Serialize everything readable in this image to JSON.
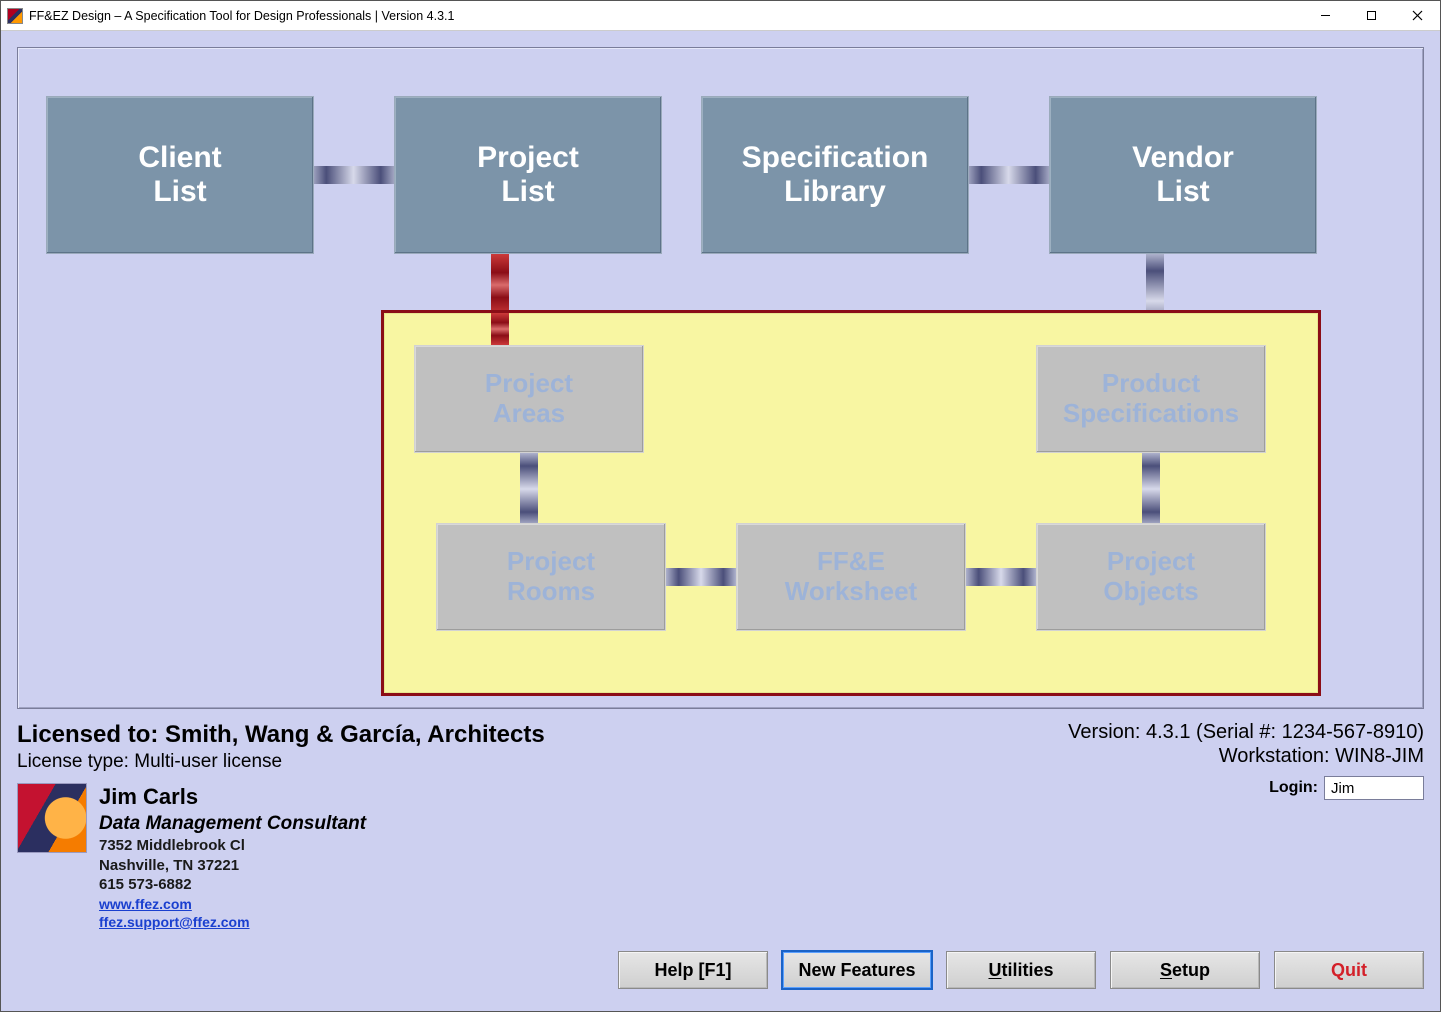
{
  "window": {
    "title": "FF&EZ Design – A Specification Tool for Design Professionals | Version 4.3.1"
  },
  "nodes": {
    "client_list": "Client\nList",
    "project_list": "Project\nList",
    "spec_library": "Specification\nLibrary",
    "vendor_list": "Vendor\nList",
    "project_areas": "Project\nAreas",
    "project_rooms": "Project\nRooms",
    "ffe_worksheet": "FF&E\nWorksheet",
    "project_objects": "Project\nObjects",
    "product_specs": "Product\nSpecifications"
  },
  "license": {
    "licensed_to_label": "Licensed to: ",
    "licensed_to_value": "Smith, Wang & García, Architects",
    "license_type_label": "License type: ",
    "license_type_value": "Multi-user license"
  },
  "version": {
    "version_label": "Version: ",
    "version_value": "4.3.1",
    "serial_label": "  (Serial #: ",
    "serial_value": "1234-567-8910",
    "serial_close": ")",
    "workstation_label": "Workstation: ",
    "workstation_value": "WIN8-JIM"
  },
  "login": {
    "label": "Login:",
    "value": "Jim"
  },
  "consultant": {
    "name": "Jim Carls",
    "title": "Data Management Consultant",
    "addr1": "7352 Middlebrook Cl",
    "addr2": "Nashville, TN  37221",
    "phone": "615 573-6882",
    "web": "www.ffez.com",
    "email": "ffez.support@ffez.com"
  },
  "buttons": {
    "help": "Help [F1]",
    "new_features": "New Features",
    "utilities_pre": "",
    "utilities_u": "U",
    "utilities_post": "tilities",
    "setup_pre": "",
    "setup_u": "S",
    "setup_post": "etup",
    "quit": "Quit"
  }
}
